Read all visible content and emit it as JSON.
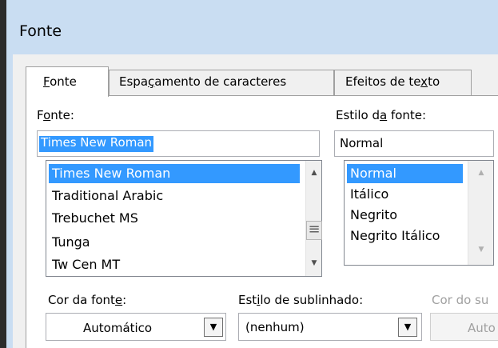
{
  "window": {
    "title": "Fonte"
  },
  "tabs": [
    {
      "label_pre": "",
      "label_u": "F",
      "label_post": "onte"
    },
    {
      "label_pre": "Espa",
      "label_u": "ç",
      "label_post": "amento de caracteres"
    },
    {
      "label_pre": "Efeitos de te",
      "label_u": "x",
      "label_post": "to"
    }
  ],
  "font": {
    "label_pre": "F",
    "label_u": "o",
    "label_post": "nte:",
    "value": "Times New Roman",
    "options": [
      "Times New Roman",
      "Traditional Arabic",
      "Trebuchet MS",
      "Tunga",
      "Tw Cen MT"
    ]
  },
  "style": {
    "label_pre": "Estilo d",
    "label_u": "a",
    "label_post": " fonte:",
    "value": "Normal",
    "options": [
      "Normal",
      "Itálico",
      "Negrito",
      "Negrito Itálico"
    ]
  },
  "font_color": {
    "label_pre": "Cor da font",
    "label_u": "e",
    "label_post": ":",
    "value": "Automático"
  },
  "underline_style": {
    "label_pre": "Est",
    "label_u": "i",
    "label_post": "lo de sublinhado:",
    "value": "(nenhum)"
  },
  "underline_color": {
    "label": "Cor do su",
    "value": "Auto"
  },
  "icons": {
    "up": "▲",
    "down": "▼",
    "grip": "≡"
  }
}
